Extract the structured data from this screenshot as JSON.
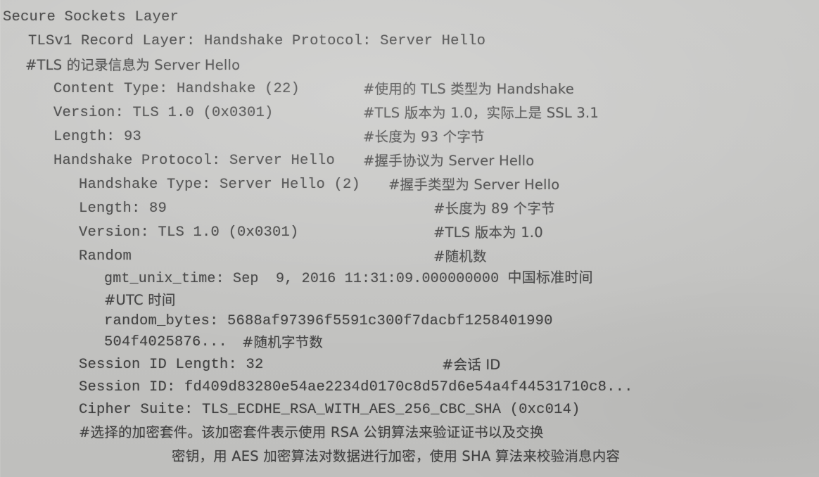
{
  "document": {
    "kind": "packet-dissection-listing",
    "title": "Secure Sockets Layer",
    "background_color": "#c8c8c6",
    "text_color": "#414141"
  },
  "lines": [
    {
      "id": "ssl-root",
      "indent": 0,
      "text": "Secure Sockets Layer",
      "comment": ""
    },
    {
      "id": "record-layer",
      "indent": 1,
      "text": "TLSv1 Record Layer: Handshake Protocol: Server Hello",
      "comment": ""
    },
    {
      "id": "record-layer-note",
      "indent": 1,
      "text": "",
      "comment": "#TLS 的记录信息为 Server Hello"
    },
    {
      "id": "content-type",
      "indent": 2,
      "text": "Content Type: Handshake (22)",
      "comment": "#使用的 TLS 类型为 Handshake"
    },
    {
      "id": "record-version",
      "indent": 2,
      "text": "Version: TLS 1.0 (0x0301)",
      "comment": "#TLS 版本为 1.0，实际上是 SSL 3.1"
    },
    {
      "id": "record-length",
      "indent": 2,
      "text": "Length: 93",
      "comment": "#长度为 93 个字节"
    },
    {
      "id": "handshake-protocol",
      "indent": 2,
      "text": "Handshake Protocol: Server Hello",
      "comment": "#握手协议为 Server Hello"
    },
    {
      "id": "handshake-type",
      "indent": 3,
      "text": "Handshake Type: Server Hello (2)",
      "comment": "#握手类型为 Server Hello"
    },
    {
      "id": "handshake-length",
      "indent": 3,
      "text": "Length: 89",
      "comment": "#长度为 89 个字节"
    },
    {
      "id": "handshake-version",
      "indent": 3,
      "text": "Version: TLS 1.0 (0x0301)",
      "comment": "#TLS 版本为 1.0"
    },
    {
      "id": "random",
      "indent": 3,
      "text": "Random",
      "comment": "#随机数"
    },
    {
      "id": "gmt-unix-time",
      "indent": 4,
      "text": "gmt_unix_time: Sep  9, 2016 11:31:09.000000000 中国标准时间",
      "comment": ""
    },
    {
      "id": "gmt-unix-time-note",
      "indent": 4,
      "text": "",
      "comment": "#UTC 时间"
    },
    {
      "id": "random-bytes",
      "indent": 4,
      "text": "random_bytes: 5688af97396f5591c300f7dacbf1258401990",
      "comment": ""
    },
    {
      "id": "random-bytes-cont",
      "indent": 4,
      "text": "504f4025876...",
      "comment": "#随机字节数"
    },
    {
      "id": "session-id-length",
      "indent": 3,
      "text": "Session ID Length: 32",
      "comment": "#会话 ID"
    },
    {
      "id": "session-id",
      "indent": 3,
      "text": "Session ID: fd409d83280e54ae2234d0170c8d57d6e54a4f44531710c8...",
      "comment": ""
    },
    {
      "id": "cipher-suite",
      "indent": 3,
      "text": "Cipher Suite: TLS_ECDHE_RSA_WITH_AES_256_CBC_SHA (0xc014)",
      "comment": ""
    },
    {
      "id": "cipher-suite-note-1",
      "indent": 3,
      "text": "",
      "comment": "#选择的加密套件。该加密套件表示使用 RSA 公钥算法来验证证书以及交换"
    },
    {
      "id": "cipher-suite-note-2",
      "indent": 6,
      "text": "",
      "comment": "密钥，用 AES 加密算法对数据进行加密，使用 SHA 算法来校验消息内容"
    }
  ],
  "layout": {
    "line_tops": [
      8,
      42,
      76,
      110,
      144,
      178,
      212,
      246,
      280,
      314,
      348,
      382,
      416,
      443,
      470,
      504,
      538,
      572,
      604,
      638
    ],
    "text_left": [
      4,
      40,
      40,
      76,
      76,
      76,
      76,
      112,
      112,
      112,
      112,
      148,
      148,
      148,
      148,
      112,
      112,
      112,
      112,
      244
    ],
    "comment_left": [
      0,
      0,
      76,
      516,
      516,
      516,
      516,
      552,
      552,
      552,
      552,
      0,
      148,
      0,
      380,
      628,
      0,
      0,
      112,
      244
    ]
  }
}
